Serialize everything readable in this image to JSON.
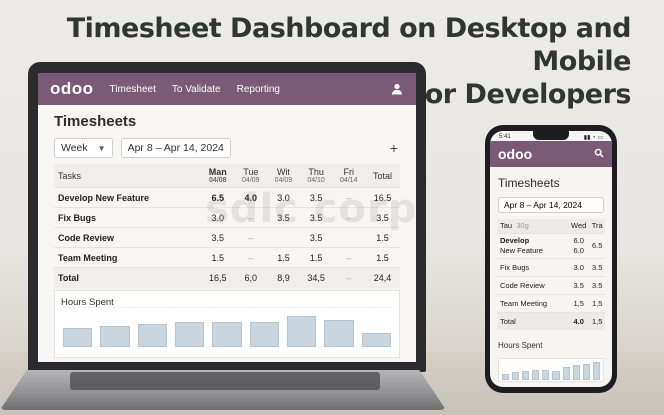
{
  "headline": {
    "line1": "Timesheet Dashboard on Desktop and Mobile",
    "line2": "for Developers"
  },
  "watermark": "sdlc corp",
  "laptop": {
    "nav": {
      "logo": "odoo",
      "links": [
        "Timesheet",
        "To Validate",
        "Reporting"
      ],
      "user_icon": "user-icon"
    },
    "title": "Timesheets",
    "period": "Week",
    "date_range": "Apr 8 – Apr 14, 2024",
    "add_icon": "+",
    "columns": [
      {
        "day": "Tasks",
        "date": ""
      },
      {
        "day": "Man",
        "date": "04/08"
      },
      {
        "day": "Tue",
        "date": "04/09"
      },
      {
        "day": "Wit",
        "date": "04/09"
      },
      {
        "day": "Thu",
        "date": "04/10"
      },
      {
        "day": "Fri",
        "date": "04/14"
      },
      {
        "day": "Total",
        "date": ""
      }
    ],
    "rows": [
      {
        "task": "Develop New Feature",
        "cells": [
          "6.5",
          "4.0",
          "3.0",
          "3.5",
          "–",
          "16.5"
        ]
      },
      {
        "task": "Fix Bugs",
        "cells": [
          "3.0",
          "–",
          "3.5",
          "3.5",
          "–",
          "3.5"
        ]
      },
      {
        "task": "Code Review",
        "cells": [
          "3.5",
          "–",
          "",
          "3.5",
          "",
          "1.5"
        ]
      },
      {
        "task": "Team Meeting",
        "cells": [
          "1.5",
          "–",
          "1.5",
          "1.5",
          "–",
          "1.5"
        ]
      }
    ],
    "total_row": {
      "task": "Total",
      "cells": [
        "16,5",
        "6,0",
        "8,9",
        "34,5",
        "–",
        "24,4"
      ]
    },
    "hours_title": "Hours Spent",
    "bar_levels": [
      0.5,
      0.55,
      0.6,
      0.65,
      0.65,
      0.65,
      0.8,
      0.68,
      0.35
    ]
  },
  "phone": {
    "status": {
      "time": "5:41",
      "icons": "▮▮ ◔ ▭"
    },
    "nav": {
      "logo": "odoo",
      "search_icon": "search-icon"
    },
    "title": "Timesheets",
    "date_range": "Apr 8 – Apr 14, 2024",
    "columns": [
      "Tau",
      "30g",
      "Wed",
      "Tra"
    ],
    "rows": [
      {
        "task": "Develop",
        "task2": "New Feature",
        "cells": [
          "6.0",
          "6.5"
        ],
        "cells2": [
          "6.0",
          ""
        ]
      },
      {
        "task": "Fix Bugs",
        "cells": [
          "3.0",
          "3.5"
        ]
      },
      {
        "task": "Code Review",
        "cells": [
          "3.5",
          "3.5"
        ]
      },
      {
        "task": "Team Meeting",
        "cells": [
          "1,5",
          "1,5"
        ]
      }
    ],
    "total_row": {
      "task": "Total",
      "cells": [
        "4.0",
        "1,5"
      ]
    },
    "hours_title": "Hours Spent",
    "bar_levels": [
      0.3,
      0.4,
      0.45,
      0.5,
      0.5,
      0.45,
      0.6,
      0.7,
      0.75,
      0.85
    ]
  }
}
